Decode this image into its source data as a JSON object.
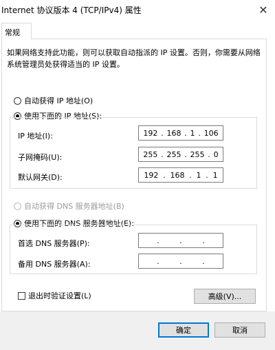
{
  "window": {
    "title": "Internet 协议版本 4 (TCP/IPv4) 属性"
  },
  "tab": {
    "label": "常规"
  },
  "intro_text": "如果网络支持此功能，则可以获取自动指派的 IP 设置。否则，你需要从网络系统管理员处获得适当的 IP 设置。",
  "ip_section": {
    "auto_option": "自动获得 IP 地址(O)",
    "manual_option": "使用下面的 IP 地址(S):",
    "selected": "manual",
    "fields": [
      {
        "label": "IP 地址(I):",
        "octets": [
          "192",
          "168",
          "1",
          "106"
        ]
      },
      {
        "label": "子网掩码(U):",
        "octets": [
          "255",
          "255",
          "255",
          "0"
        ]
      },
      {
        "label": "默认网关(D):",
        "octets": [
          "192",
          "168",
          "1",
          "1"
        ]
      }
    ]
  },
  "dns_section": {
    "auto_option": "自动获得 DNS 服务器地址(B)",
    "manual_option": "使用下面的 DNS 服务器地址(E):",
    "selected": "manual",
    "fields": [
      {
        "label": "首选 DNS 服务器(P):",
        "octets": [
          "",
          "",
          "",
          ""
        ]
      },
      {
        "label": "备用 DNS 服务器(A):",
        "octets": [
          "",
          "",
          "",
          ""
        ]
      }
    ]
  },
  "validate_checkbox": {
    "label": "退出时验证设置(L)",
    "checked": false
  },
  "buttons": {
    "advanced": "高级(V)...",
    "ok": "确定",
    "cancel": "取消"
  },
  "icons": {
    "close": "close-icon"
  },
  "colors": {
    "primary_border": "#0078d7",
    "disabled_text": "#9b9b9b"
  }
}
